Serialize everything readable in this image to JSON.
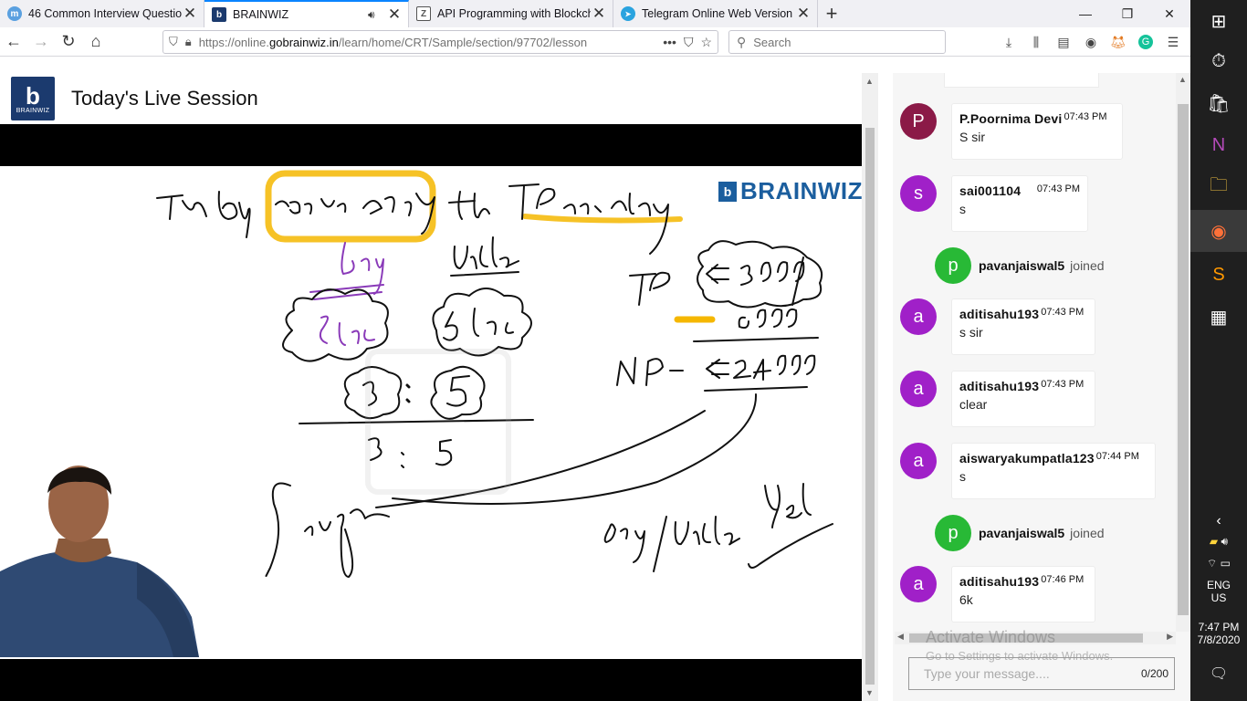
{
  "tabs": [
    {
      "title": "46 Common Interview Questio",
      "favicon_color": "#5aa0e0",
      "favicon_letter": "m"
    },
    {
      "title": "BRAINWIZ",
      "favicon_color": "#1b3a6e",
      "favicon_letter": "b",
      "active": true,
      "audio": true
    },
    {
      "title": "API Programming with Blockch",
      "favicon_color": "#555555",
      "favicon_letter": "Z"
    },
    {
      "title": "Telegram Online Web Version",
      "favicon_color": "#2aa3df",
      "favicon_letter": "➤"
    }
  ],
  "address": {
    "prefix": "https://online.",
    "domain": "gobrainwiz.in",
    "path": "/learn/home/CRT/Sample/section/97702/lesson"
  },
  "search": {
    "placeholder": "Search"
  },
  "page": {
    "title": "Today's Live Session",
    "logo_text": "BRAINWIZ",
    "logo_letter": "b"
  },
  "board": {
    "watermark": "BRAINWIZ"
  },
  "chat": {
    "messages": [
      {
        "type": "msg",
        "initial": "P",
        "color": "#8b1a47",
        "name": "P.Poornima Devi",
        "time": "07:43 PM",
        "text": "S sir"
      },
      {
        "type": "msg",
        "initial": "s",
        "color": "#a020c8",
        "name": "sai001104",
        "time": "07:43 PM",
        "text": "s"
      },
      {
        "type": "join",
        "initial": "p",
        "color": "#28b936",
        "name": "pavanjaiswal5",
        "text": "joined"
      },
      {
        "type": "msg",
        "initial": "a",
        "color": "#a020c8",
        "name": "aditisahu193",
        "time": "07:43 PM",
        "text": "s sir"
      },
      {
        "type": "msg",
        "initial": "a",
        "color": "#a020c8",
        "name": "aditisahu193",
        "time": "07:43 PM",
        "text": "clear"
      },
      {
        "type": "msg",
        "initial": "a",
        "color": "#a020c8",
        "name": "aiswaryakumpatla123",
        "time": "07:44 PM",
        "text": "s"
      },
      {
        "type": "join",
        "initial": "p",
        "color": "#28b936",
        "name": "pavanjaiswal5",
        "text": "joined"
      },
      {
        "type": "msg",
        "initial": "a",
        "color": "#a020c8",
        "name": "aditisahu193",
        "time": "07:46 PM",
        "text": "6k"
      }
    ],
    "input_placeholder": "Type your message....",
    "counter": "0/200",
    "activate_title": "Activate Windows",
    "activate_sub": "Go to Settings to activate Windows."
  },
  "tray": {
    "lang1": "ENG",
    "lang2": "US",
    "time": "7:47 PM",
    "date": "7/8/2020"
  }
}
